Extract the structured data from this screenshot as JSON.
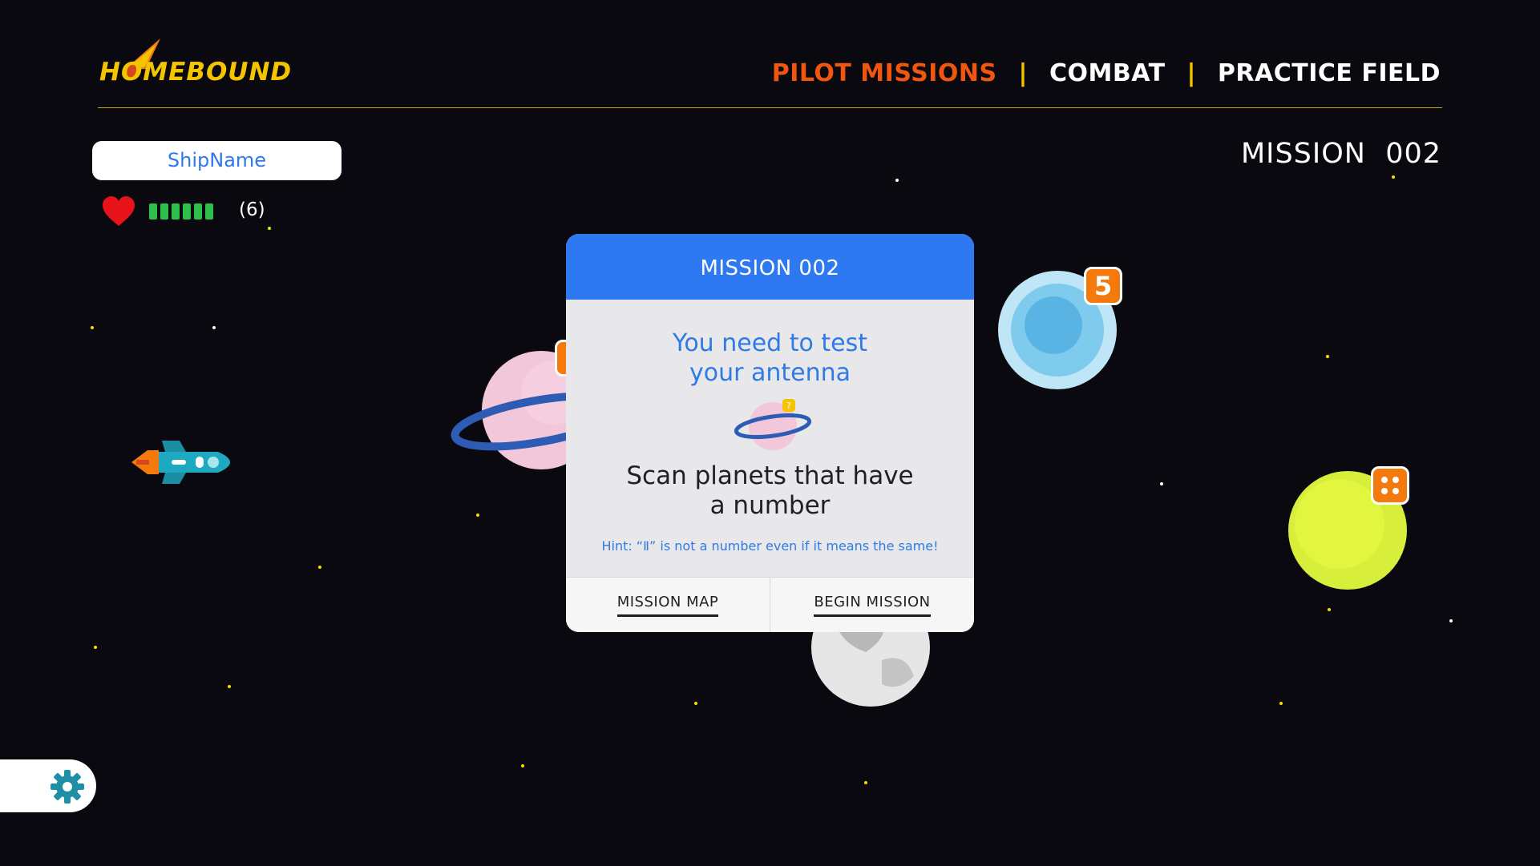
{
  "app": {
    "logo_text": "HOMEBOUND",
    "accent_orange": "#f0560e",
    "accent_yellow": "#f5c400",
    "primary_blue": "#2e79f2"
  },
  "nav": {
    "items": [
      {
        "label": "PILOT MISSIONS",
        "active": true
      },
      {
        "label": "COMBAT",
        "active": false
      },
      {
        "label": "PRACTICE FIELD",
        "active": false
      }
    ],
    "separator": "|"
  },
  "mission_label": "MISSION  002",
  "player": {
    "ship_name": "ShipName",
    "health_segments": 6,
    "health_count_text": "(6)",
    "heart_icon": "heart-icon"
  },
  "planets": [
    {
      "name": "pink-ringed-planet",
      "badge": "",
      "badge_partially_hidden": true
    },
    {
      "name": "blue-planet",
      "badge": "5"
    },
    {
      "name": "yellow-green-planet",
      "badge": "dice-four-icon"
    },
    {
      "name": "grey-moon-planet",
      "badge": ""
    }
  ],
  "modal": {
    "title": "MISSION 002",
    "subtitle_line1": "You need to test",
    "subtitle_line2": "your antenna",
    "task_line1": "Scan planets that have",
    "task_line2": "a number",
    "hint": "Hint:  “Ⅱ” is not a number even if it means the same!",
    "buttons": {
      "map": "MISSION MAP",
      "begin": "BEGIN MISSION"
    }
  },
  "settings": {
    "icon": "gear-icon"
  }
}
